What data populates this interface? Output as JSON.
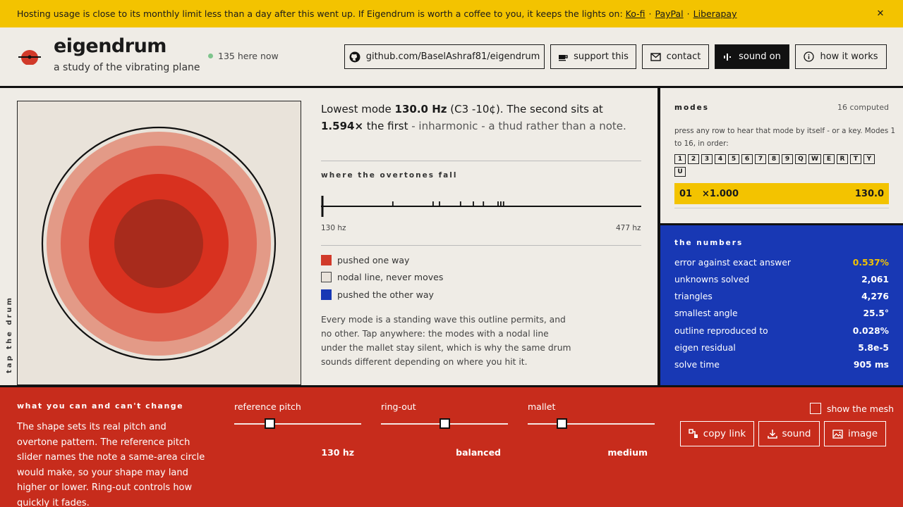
{
  "banner": {
    "text": "Hosting usage is close to its monthly limit less than a day after this went up. If Eigendrum is worth a coffee to you, it keeps the lights on:",
    "links": [
      "Ko-fi",
      "PayPal",
      "Liberapay"
    ],
    "separator": "·",
    "close": "✕"
  },
  "header": {
    "title": "eigendrum",
    "subtitle": "a study of the vibrating plane",
    "online": "135 here now",
    "buttons": {
      "github": "github.com/BaselAshraf81/eigendrum",
      "support": "support this",
      "contact": "contact",
      "sound": "sound on",
      "how": "how it works"
    }
  },
  "drum": {
    "tap_label": "tap the drum"
  },
  "summary": {
    "p1": "Lowest mode ",
    "freq": "130.0 Hz",
    "note": " (C3 -10¢). The second sits at ",
    "ratio": "1.594×",
    "p2": " the first",
    "p3": " - inharmonic - a thud rather than a note."
  },
  "overtones": {
    "heading": "where the overtones fall",
    "min_label": "130 hz",
    "max_label": "477 hz",
    "range": [
      130,
      477
    ],
    "ticks": [
      130,
      207,
      251,
      258,
      281,
      295,
      306,
      322,
      325,
      328
    ]
  },
  "legend": {
    "positive": "pushed one way",
    "nodal": "nodal line, never moves",
    "negative": "pushed the other way",
    "colors": {
      "positive": "#d13a2a",
      "nodal": "#e9e3da",
      "negative": "#1838b4"
    }
  },
  "description": "Every mode is a standing wave this outline permits, and no other. Tap anywhere: the modes with a nodal line under the mallet stay silent, which is why the same drum sounds different depending on where you hit it.",
  "modes": {
    "heading": "modes",
    "count": "16 computed",
    "help": "press any row to hear that mode by itself - or a key. Modes 1 to 16, in order:",
    "keys": [
      "1",
      "2",
      "3",
      "4",
      "5",
      "6",
      "7",
      "8",
      "9",
      "Q",
      "W",
      "E",
      "R",
      "T",
      "Y",
      "U"
    ],
    "selected": {
      "index": "01",
      "ratio": "×1.000",
      "freq": "130.0"
    }
  },
  "numbers": {
    "heading": "the numbers",
    "rows": [
      {
        "label": "error against exact answer",
        "value": "0.537%"
      },
      {
        "label": "unknowns solved",
        "value": "2,061"
      },
      {
        "label": "triangles",
        "value": "4,276"
      },
      {
        "label": "smallest angle",
        "value": "25.5°"
      },
      {
        "label": "outline reproduced to",
        "value": "0.028%"
      },
      {
        "label": "eigen residual",
        "value": "5.8e-5"
      },
      {
        "label": "solve time",
        "value": "905 ms"
      }
    ]
  },
  "controls": {
    "heading": "what you can and can't change",
    "text": "The shape sets its real pitch and overtone pattern. The reference pitch slider names the note a same-area circle would make, so your shape may land higher or lower. Ring-out controls how quickly it fades.",
    "sliders": [
      {
        "label": "reference pitch",
        "value": "130 hz",
        "level": 0.28
      },
      {
        "label": "ring-out",
        "value": "balanced",
        "level": 0.5
      },
      {
        "label": "mallet",
        "value": "medium",
        "level": 0.27
      }
    ],
    "mesh": "show the mesh",
    "copy_link": "copy link",
    "sound": "sound",
    "image": "image"
  }
}
